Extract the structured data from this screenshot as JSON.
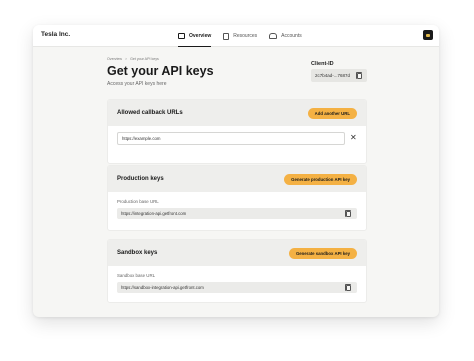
{
  "brand": "Tesla Inc.",
  "nav": [
    {
      "label": "Overview",
      "icon": "dashboard-icon",
      "active": true
    },
    {
      "label": "Resources",
      "icon": "document-icon",
      "active": false
    },
    {
      "label": "Accounts",
      "icon": "users-icon",
      "active": false
    }
  ],
  "breadcrumb": {
    "root": "Overview",
    "separator": ">",
    "current": "Get your API keys"
  },
  "page": {
    "title": "Get your API keys",
    "subtitle": "Access your API keys here"
  },
  "client": {
    "label": "Client-ID",
    "value": "2c7b4ad-...7687d"
  },
  "callback": {
    "title": "Allowed callback URLs",
    "button": "Add another URL",
    "url_value": "https://example.com"
  },
  "production": {
    "title": "Production keys",
    "button": "Generate production API key",
    "field_label": "Production base URL",
    "field_value": "https://integration-api.getfront.com"
  },
  "sandbox": {
    "title": "Sandbox keys",
    "button": "Generate sandbox API key",
    "field_label": "Sandbox base URL",
    "field_value": "https://sandbox-integration-api.getfront.com"
  },
  "colors": {
    "accent": "#f4b144",
    "header_bg": "#eeeeec",
    "page_bg": "#f6f6f4"
  }
}
